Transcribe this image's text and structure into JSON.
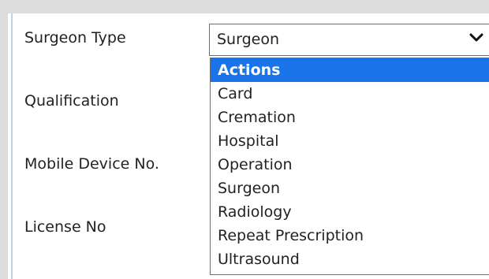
{
  "form": {
    "fields": [
      {
        "label": "Surgeon Type"
      },
      {
        "label": "Qualification"
      },
      {
        "label": "Mobile Device No."
      },
      {
        "label": "License No"
      }
    ],
    "surgeon_type_select": {
      "value": "Surgeon",
      "options": [
        "Actions",
        "Card",
        "Cremation",
        "Hospital",
        "Operation",
        "Surgeon",
        "Radiology",
        "Repeat Prescription",
        "Ultrasound"
      ],
      "highlighted_option": "Actions",
      "icon": "chevron-down-icon"
    }
  },
  "colors": {
    "highlight": "#1a73e8",
    "left_accent": "#bfd3e6",
    "page_border": "#dcdcdc"
  }
}
